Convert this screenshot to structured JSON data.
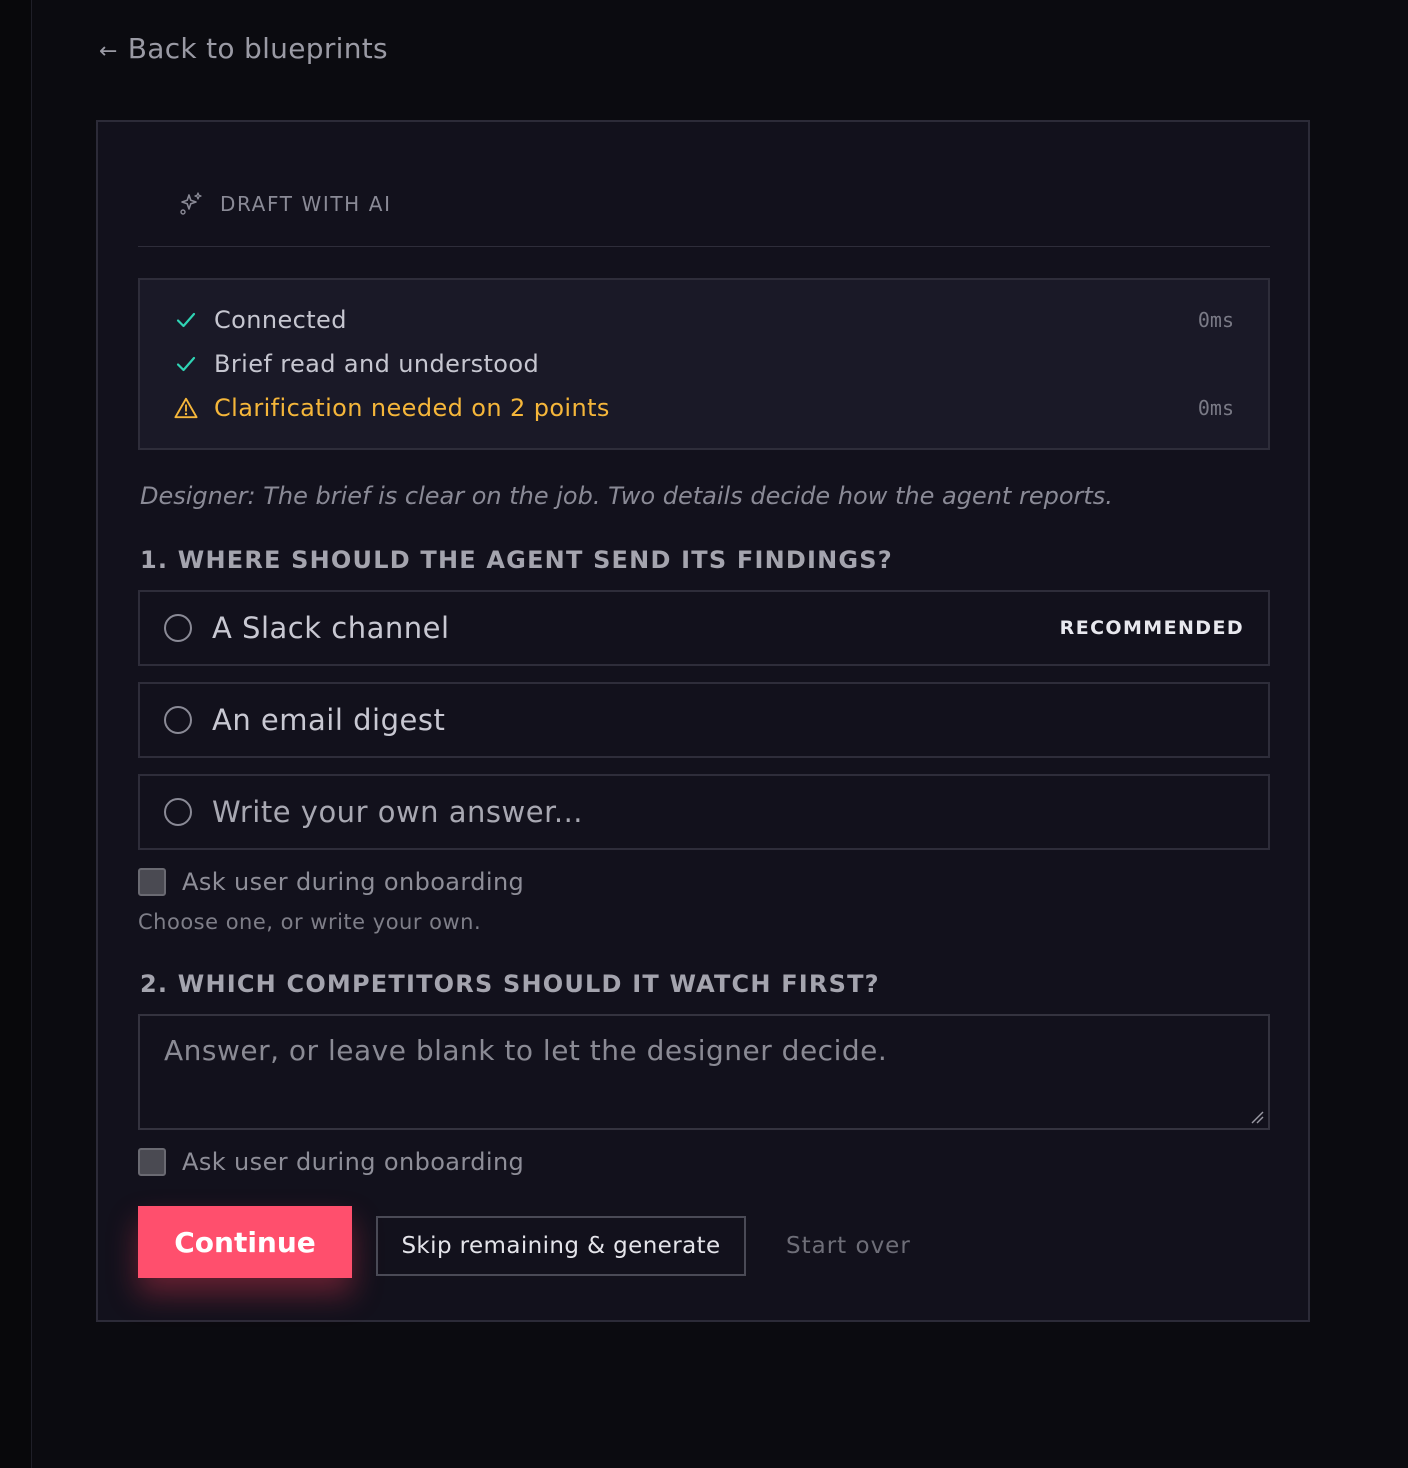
{
  "nav": {
    "back_arrow": "←",
    "back_label": "Back to blueprints"
  },
  "panel": {
    "header_icon": "sparkles-icon",
    "header_title": "DRAFT WITH AI"
  },
  "status": {
    "items": [
      {
        "icon": "check-icon",
        "label": "Connected",
        "time": "0ms",
        "state": "ok"
      },
      {
        "icon": "check-icon",
        "label": "Brief read and understood",
        "time": "",
        "state": "ok"
      },
      {
        "icon": "warning-icon",
        "label": "Clarification needed on 2 points",
        "time": "0ms",
        "state": "warn"
      }
    ]
  },
  "designer_note": "Designer: The brief is clear on the job. Two details decide how the agent reports.",
  "question1": {
    "title": "1. WHERE SHOULD THE AGENT SEND ITS FINDINGS?",
    "options": [
      {
        "label": "A Slack channel",
        "badge": "RECOMMENDED"
      },
      {
        "label": "An email digest",
        "badge": ""
      },
      {
        "label": "Write your own answer...",
        "badge": ""
      }
    ],
    "ask_user_label": "Ask user during onboarding",
    "hint": "Choose one, or write your own."
  },
  "question2": {
    "title": "2. WHICH COMPETITORS SHOULD IT WATCH FIRST?",
    "placeholder": "Answer, or leave blank to let the designer decide.",
    "ask_user_label": "Ask user during onboarding"
  },
  "actions": {
    "continue_label": "Continue",
    "skip_label": "Skip remaining & generate",
    "start_over_label": "Start over"
  },
  "colors": {
    "background": "#0b0b10",
    "panel": "#12111c",
    "accent": "#ff4f6d",
    "success": "#2fd3b4",
    "warning": "#f5b63a"
  }
}
